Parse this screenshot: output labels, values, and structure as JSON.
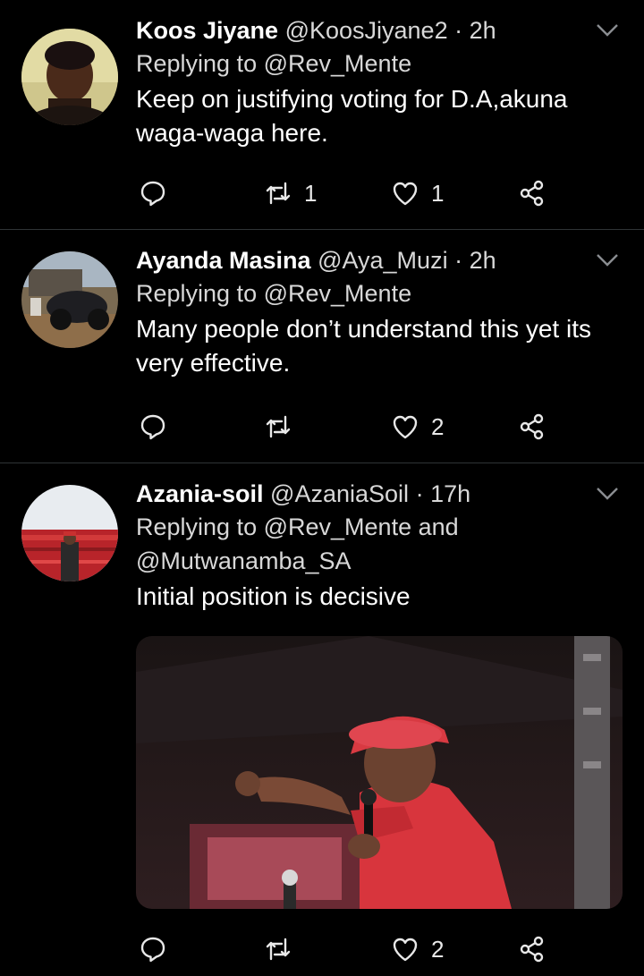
{
  "tweets": [
    {
      "name": "Koos Jiyane",
      "handle": "@KoosJiyane2",
      "dot": "·",
      "time": "2h",
      "replying_prefix": "Replying to",
      "replying_to": "@Rev_Mente",
      "text_lines": [
        "Keep on justifying voting for D.A,akuna",
        "waga-waga here."
      ],
      "retweets": "1",
      "likes": "1"
    },
    {
      "name": "Ayanda Masina",
      "handle": "@Aya_Muzi",
      "dot": "·",
      "time": "2h",
      "replying_prefix": "Replying to",
      "replying_to": "@Rev_Mente",
      "text_lines": [
        "Many people don’t understand this yet its",
        "very effective."
      ],
      "retweets": "",
      "likes": "2"
    },
    {
      "name": "Azania-soil",
      "handle": "@AzaniaSoil",
      "dot": "·",
      "time": "17h",
      "replying_prefix": "Replying to",
      "replying_to": "@Rev_Mente",
      "replying_and": "and",
      "replying_to_2": "@Mutwanamba_SA",
      "text_lines": [
        "Initial position is decisive"
      ],
      "retweets": "",
      "likes": "2"
    }
  ],
  "colors": {
    "background": "#000000",
    "text": "#ffffff",
    "secondary_text": "#d8d8d8",
    "divider": "#2f3336",
    "icon": "#e8e8e8"
  },
  "icons": [
    "reply-icon",
    "retweet-icon",
    "like-icon",
    "share-icon",
    "chevron-down-icon"
  ]
}
